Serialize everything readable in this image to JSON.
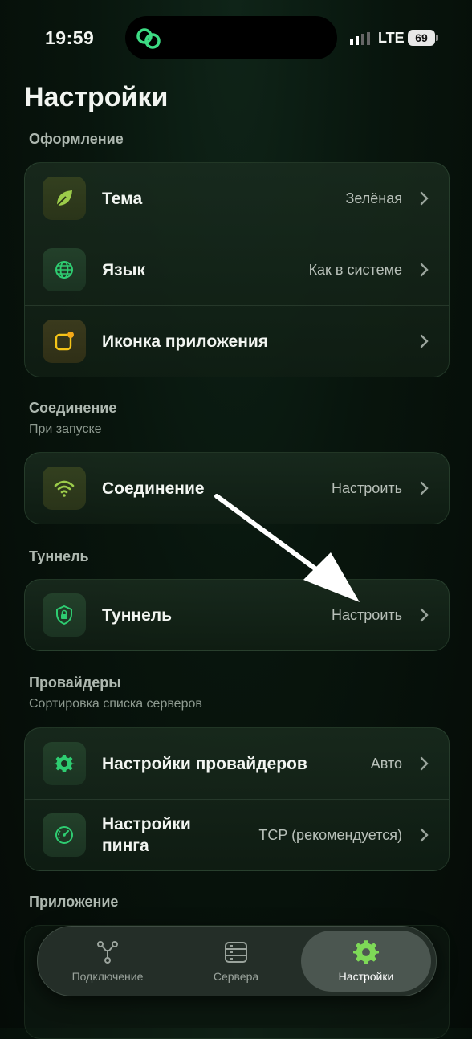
{
  "status_bar": {
    "time": "19:59",
    "network": "LTE",
    "battery": "69"
  },
  "page_title": "Настройки",
  "sections": {
    "appearance": {
      "title": "Оформление"
    },
    "connection": {
      "title": "Соединение",
      "subtitle": "При запуске"
    },
    "tunnel": {
      "title": "Туннель"
    },
    "providers": {
      "title": "Провайдеры",
      "subtitle": "Сортировка списка серверов"
    },
    "app": {
      "title": "Приложение"
    }
  },
  "rows": {
    "theme": {
      "label": "Тема",
      "value": "Зелёная",
      "icon": "leaf-icon"
    },
    "language": {
      "label": "Язык",
      "value": "Как в системе",
      "icon": "globe-icon"
    },
    "app_icon": {
      "label": "Иконка приложения",
      "value": "",
      "icon": "app-icon-icon"
    },
    "connection": {
      "label": "Соединение",
      "value": "Настроить",
      "icon": "wifi-icon"
    },
    "tunnel": {
      "label": "Туннель",
      "value": "Настроить",
      "icon": "shield-lock-icon"
    },
    "provider_settings": {
      "label": "Настройки провайдеров",
      "value": "Авто",
      "icon": "gear-icon"
    },
    "ping_settings": {
      "label": "Настройки пинга",
      "value": "TCP (рекомендуется)",
      "icon": "speedometer-icon"
    }
  },
  "tabs": [
    {
      "label": "Подключение",
      "icon": "nodes-icon",
      "active": false
    },
    {
      "label": "Сервера",
      "icon": "server-icon",
      "active": false
    },
    {
      "label": "Настройки",
      "icon": "gear-icon",
      "active": true
    }
  ],
  "colors": {
    "accent": "#7ed957",
    "background": "#07120b",
    "icon_green": "#2ecc71",
    "icon_yellow": "#f5c518"
  }
}
